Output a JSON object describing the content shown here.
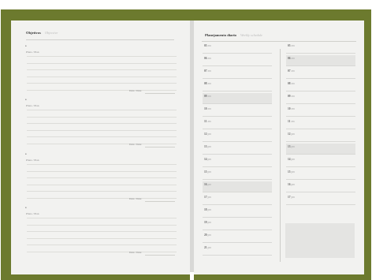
{
  "left_page": {
    "title": "Objetivos",
    "subtitle": "Objective",
    "blocks": [
      {
        "bullet": "•",
        "plan_label": "Plano / Plan",
        "due_label": "Data / Date"
      },
      {
        "bullet": "•",
        "plan_label": "Plano / Plan",
        "due_label": "Data / Date"
      },
      {
        "bullet": "•",
        "plan_label": "Plano / Plan",
        "due_label": "Data / Date"
      },
      {
        "bullet": "•",
        "plan_label": "Plano / Plan",
        "due_label": "Data / Date"
      }
    ]
  },
  "right_page": {
    "title": "Planejamento diario",
    "subtitle": "Weekly schedule",
    "left_column": [
      {
        "hour": "05",
        "suffix": "am"
      },
      {
        "hour": "06",
        "suffix": "am"
      },
      {
        "hour": "07",
        "suffix": "am"
      },
      {
        "hour": "08",
        "suffix": "am"
      },
      {
        "hour": "09",
        "suffix": "am",
        "shaded": true
      },
      {
        "hour": "10",
        "suffix": "am"
      },
      {
        "hour": "11",
        "suffix": "am"
      },
      {
        "hour": "12",
        "suffix": "pm"
      },
      {
        "hour": "13",
        "suffix": "pm"
      },
      {
        "hour": "14",
        "suffix": "pm"
      },
      {
        "hour": "15",
        "suffix": "pm"
      },
      {
        "hour": "16",
        "suffix": "pm",
        "shaded": true
      },
      {
        "hour": "17",
        "suffix": "pm"
      },
      {
        "hour": "18",
        "suffix": "pm"
      },
      {
        "hour": "19",
        "suffix": "pm"
      },
      {
        "hour": "20",
        "suffix": "pm"
      },
      {
        "hour": "21",
        "suffix": "pm"
      }
    ],
    "right_column": [
      {
        "hour": "05",
        "suffix": "am"
      },
      {
        "hour": "06",
        "suffix": "am",
        "shaded": true
      },
      {
        "hour": "07",
        "suffix": "am"
      },
      {
        "hour": "08",
        "suffix": "am"
      },
      {
        "hour": "09",
        "suffix": "am"
      },
      {
        "hour": "10",
        "suffix": "am"
      },
      {
        "hour": "11",
        "suffix": "am"
      },
      {
        "hour": "12",
        "suffix": "pm"
      },
      {
        "hour": "13",
        "suffix": "pm",
        "shaded": true
      },
      {
        "hour": "14",
        "suffix": "pm"
      },
      {
        "hour": "15",
        "suffix": "pm"
      },
      {
        "hour": "16",
        "suffix": "pm"
      },
      {
        "hour": "17",
        "suffix": "pm"
      }
    ]
  },
  "colors": {
    "cover": "#6c7a2e",
    "paper": "#f2f2f0",
    "shade": "#e4e4e2"
  }
}
